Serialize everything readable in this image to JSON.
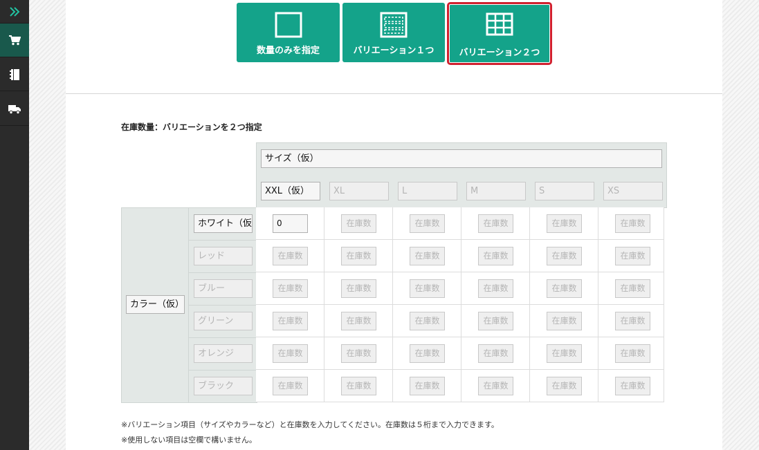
{
  "sidebar": {
    "items": [
      {
        "icon": "double-chevron-right-icon"
      },
      {
        "icon": "cart-icon",
        "active": true
      },
      {
        "icon": "notebook-icon"
      },
      {
        "icon": "truck-icon"
      }
    ]
  },
  "modes": {
    "quantity_only": "数量のみを指定",
    "variation_one": "バリエーション１つ",
    "variation_two": "バリエーション２つ",
    "selected": "variation_two"
  },
  "section_title": "在庫数量：バリエーションを２つ指定",
  "variation1": {
    "name": "サイズ（仮）",
    "options": [
      {
        "value": "XXL（仮）",
        "placeholder": ""
      },
      {
        "value": "",
        "placeholder": "XL"
      },
      {
        "value": "",
        "placeholder": "L"
      },
      {
        "value": "",
        "placeholder": "M"
      },
      {
        "value": "",
        "placeholder": "S"
      },
      {
        "value": "",
        "placeholder": "XS"
      }
    ]
  },
  "variation2": {
    "name": "カラー（仮）",
    "options": [
      {
        "value": "ホワイト（仮",
        "placeholder": ""
      },
      {
        "value": "",
        "placeholder": "レッド"
      },
      {
        "value": "",
        "placeholder": "ブルー"
      },
      {
        "value": "",
        "placeholder": "グリーン"
      },
      {
        "value": "",
        "placeholder": "オレンジ"
      },
      {
        "value": "",
        "placeholder": "ブラック"
      }
    ]
  },
  "stock_placeholder": "在庫数",
  "stock_values": [
    [
      "0",
      "",
      "",
      "",
      "",
      ""
    ],
    [
      "",
      "",
      "",
      "",
      "",
      ""
    ],
    [
      "",
      "",
      "",
      "",
      "",
      ""
    ],
    [
      "",
      "",
      "",
      "",
      "",
      ""
    ],
    [
      "",
      "",
      "",
      "",
      "",
      ""
    ],
    [
      "",
      "",
      "",
      "",
      "",
      ""
    ]
  ],
  "notes": [
    "※バリエーション項目（サイズやカラーなど）と在庫数を入力してください。在庫数は５桁まで入力できます。",
    "※使用しない項目は空欄で構いません。"
  ],
  "colors": {
    "accent": "#14a38a",
    "selected_border": "#d0202e",
    "sidebar_bg": "#2b2b2b",
    "sidebar_active": "#19594c"
  }
}
